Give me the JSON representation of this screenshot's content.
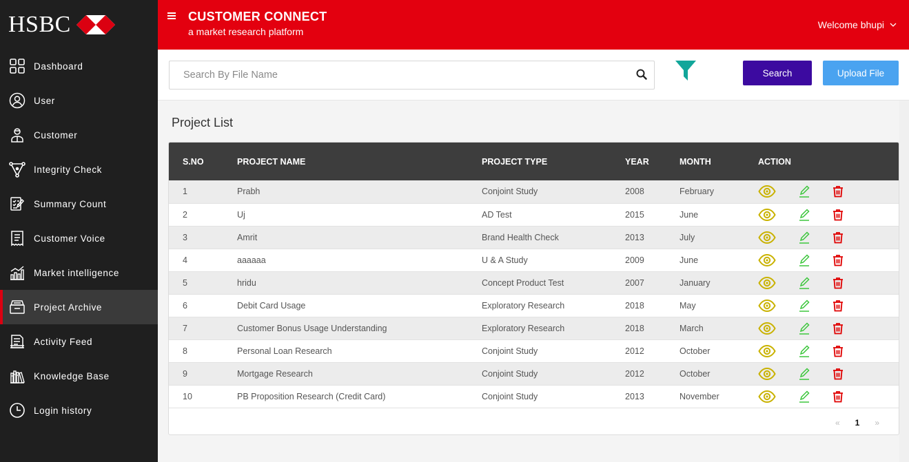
{
  "brand": {
    "logo_text": "HSBC"
  },
  "sidebar": {
    "items": [
      {
        "label": "Dashboard",
        "icon": "dashboard-icon"
      },
      {
        "label": "User",
        "icon": "user-icon"
      },
      {
        "label": "Customer",
        "icon": "customer-icon"
      },
      {
        "label": "Integrity Check",
        "icon": "integrity-icon"
      },
      {
        "label": "Summary Count",
        "icon": "summary-icon"
      },
      {
        "label": "Customer Voice",
        "icon": "voice-icon"
      },
      {
        "label": "Market intelligence",
        "icon": "chart-icon"
      },
      {
        "label": "Project Archive",
        "icon": "archive-icon",
        "active": true
      },
      {
        "label": "Activity Feed",
        "icon": "feed-icon"
      },
      {
        "label": "Knowledge Base",
        "icon": "library-icon"
      },
      {
        "label": "Login history",
        "icon": "clock-icon"
      }
    ]
  },
  "header": {
    "title": "CUSTOMER CONNECT",
    "subtitle": "a market research platform",
    "welcome": "Welcome bhupi"
  },
  "toolbar": {
    "search_placeholder": "Search By File Name",
    "search_value": "",
    "search_button": "Search",
    "upload_button": "Upload File"
  },
  "main": {
    "page_title": "Project List",
    "columns": [
      "S.NO",
      "PROJECT NAME",
      "PROJECT TYPE",
      "YEAR",
      "MONTH",
      "ACTION"
    ],
    "rows": [
      [
        "1",
        "Prabh",
        "Conjoint Study",
        "2008",
        "February"
      ],
      [
        "2",
        "Uj",
        "AD Test",
        "2015",
        "June"
      ],
      [
        "3",
        "Amrit",
        "Brand Health Check",
        "2013",
        "July"
      ],
      [
        "4",
        "aaaaaa",
        "U & A Study",
        "2009",
        "June"
      ],
      [
        "5",
        "hridu",
        "Concept Product Test",
        "2007",
        "January"
      ],
      [
        "6",
        "Debit Card Usage",
        "Exploratory Research",
        "2018",
        "May"
      ],
      [
        "7",
        "Customer Bonus Usage Understanding",
        "Exploratory Research",
        "2018",
        "March"
      ],
      [
        "8",
        "Personal Loan Research",
        "Conjoint Study",
        "2012",
        "October"
      ],
      [
        "9",
        "Mortgage Research",
        "Conjoint Study",
        "2012",
        "October"
      ],
      [
        "10",
        "PB Proposition Research (Credit Card)",
        "Conjoint Study",
        "2013",
        "November"
      ]
    ],
    "pagination": {
      "prev": "«",
      "current": "1",
      "next": "»"
    }
  },
  "colors": {
    "brand_red": "#e3000f",
    "sidebar_bg": "#1f1f1f",
    "search_btn": "#3c0aa0",
    "upload_btn": "#4aa3f0",
    "view_icon": "#c9b200",
    "edit_icon": "#3cc63c",
    "delete_icon": "#e00000",
    "filter_icon": "#11a69a"
  }
}
